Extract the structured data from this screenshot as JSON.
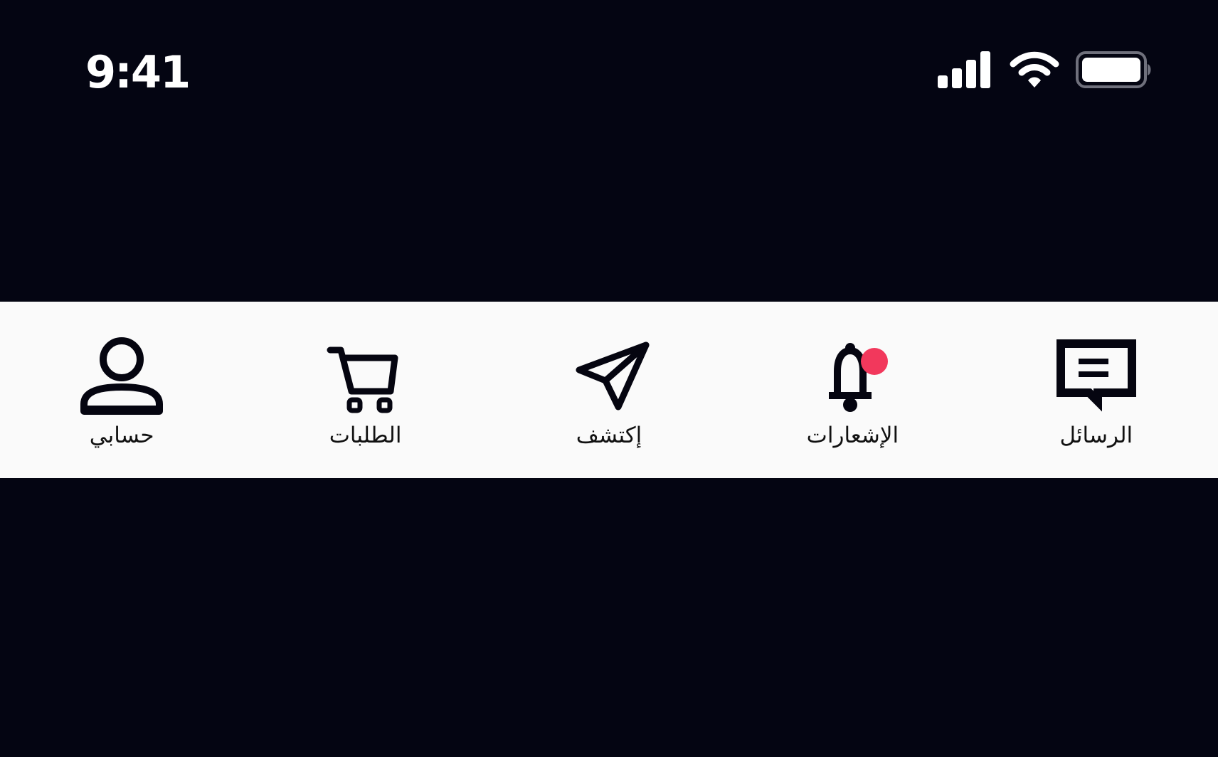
{
  "status_bar": {
    "time": "9:41",
    "icons": [
      "cellular-signal-icon",
      "wifi-icon",
      "battery-icon"
    ]
  },
  "tab_bar": {
    "items": [
      {
        "key": "messages",
        "label": "الرسائل",
        "icon": "message-icon",
        "badge": false
      },
      {
        "key": "notifications",
        "label": "الإشعارات",
        "icon": "bell-icon",
        "badge": true
      },
      {
        "key": "discover",
        "label": "إكتشف",
        "icon": "send-icon",
        "badge": false
      },
      {
        "key": "orders",
        "label": "الطلبات",
        "icon": "cart-icon",
        "badge": false
      },
      {
        "key": "account",
        "label": "حسابي",
        "icon": "user-icon",
        "badge": false
      }
    ]
  },
  "colors": {
    "background": "#040512",
    "tab_bar_background": "#fafafa",
    "icon": "#050510",
    "label": "#111111",
    "badge": "#f2385c",
    "status_text": "#ffffff"
  }
}
